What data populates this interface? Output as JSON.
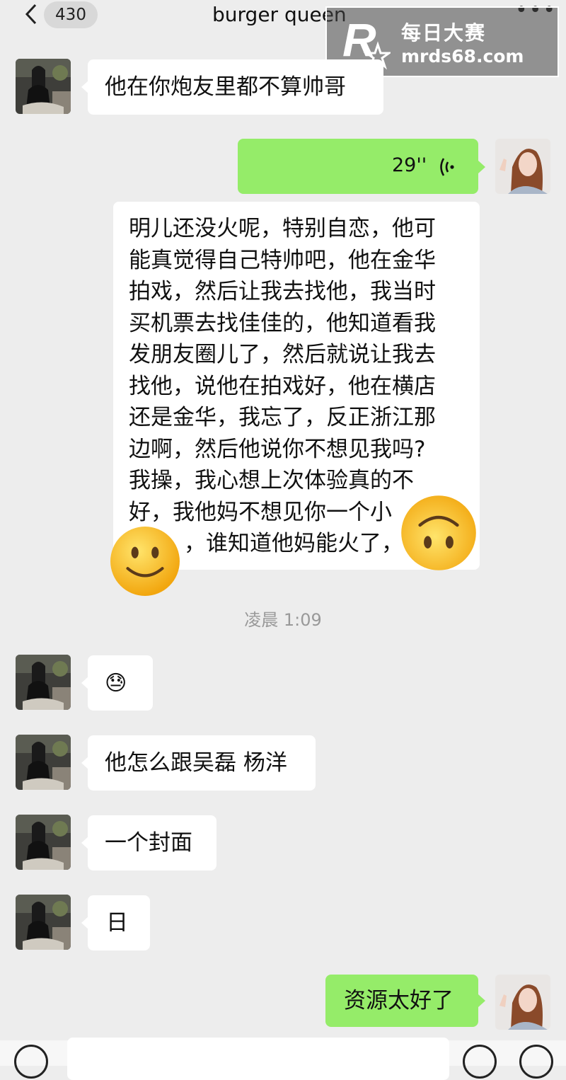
{
  "header": {
    "badge": "430",
    "title": "burger queen",
    "more": "•••"
  },
  "watermark": {
    "name": "每日大赛",
    "url": "mrds68.com"
  },
  "messages": {
    "m1": "他在你炮友里都不算帅哥",
    "voice_duration": "29''",
    "long_lines": [
      "明儿还没火呢，特别自恋，他可",
      "能真觉得自己特帅吧，他在金华",
      "拍戏，然后让我去找他，我当时",
      "买机票去找佳佳的，他知道看我",
      "发朋友圈儿了，然后就说让我去",
      "找他，说他在拍戏好，他在横店",
      "还是金华，我忘了，反正浙江那",
      "边啊，然后他说你不想见我吗?",
      "我操，我心想上次体验真的不",
      "好，我他妈不想见你一个小",
      "，谁知道他妈能火了，"
    ],
    "timestamp": "凌晨 1:09",
    "m_emoji": "😓",
    "m2": "他怎么跟吴磊 杨洋",
    "m3": "一个封面",
    "m4": "日",
    "m5": "资源太好了"
  },
  "stickers": {
    "left": "smiling-face",
    "right": "upside-down-face"
  },
  "colors": {
    "background": "#ededed",
    "sent_bubble": "#95ec69",
    "received_bubble": "#ffffff",
    "timestamp": "#999999"
  }
}
